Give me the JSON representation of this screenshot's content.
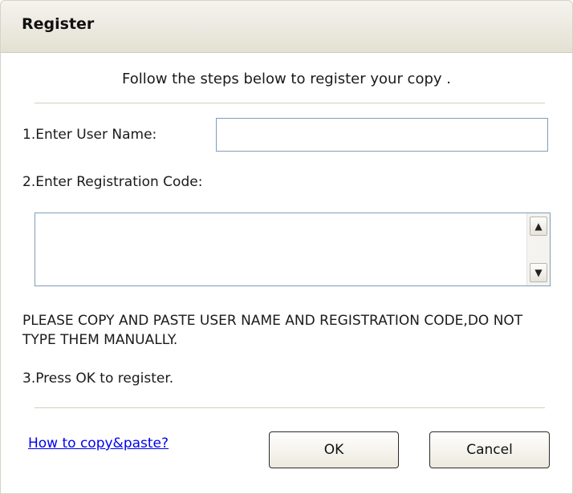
{
  "window": {
    "title": "Register"
  },
  "intro": "Follow the steps below to register your copy .",
  "form": {
    "user_name_label": "1.Enter User Name:",
    "user_name_value": "",
    "code_label": "2.Enter Registration Code:",
    "code_value": "",
    "warning": "PLEASE COPY AND PASTE USER NAME AND REGISTRATION CODE,DO NOT TYPE THEM MANUALLY.",
    "step3": "3.Press OK to register."
  },
  "scrollbar": {
    "up_icon": "▲",
    "down_icon": "▼"
  },
  "footer": {
    "help_link": "How to copy&paste?",
    "ok_label": "OK",
    "cancel_label": "Cancel"
  },
  "colors": {
    "link": "#0000ee",
    "input_border": "#7f9db9",
    "dialog_bg": "#ece9d8"
  }
}
